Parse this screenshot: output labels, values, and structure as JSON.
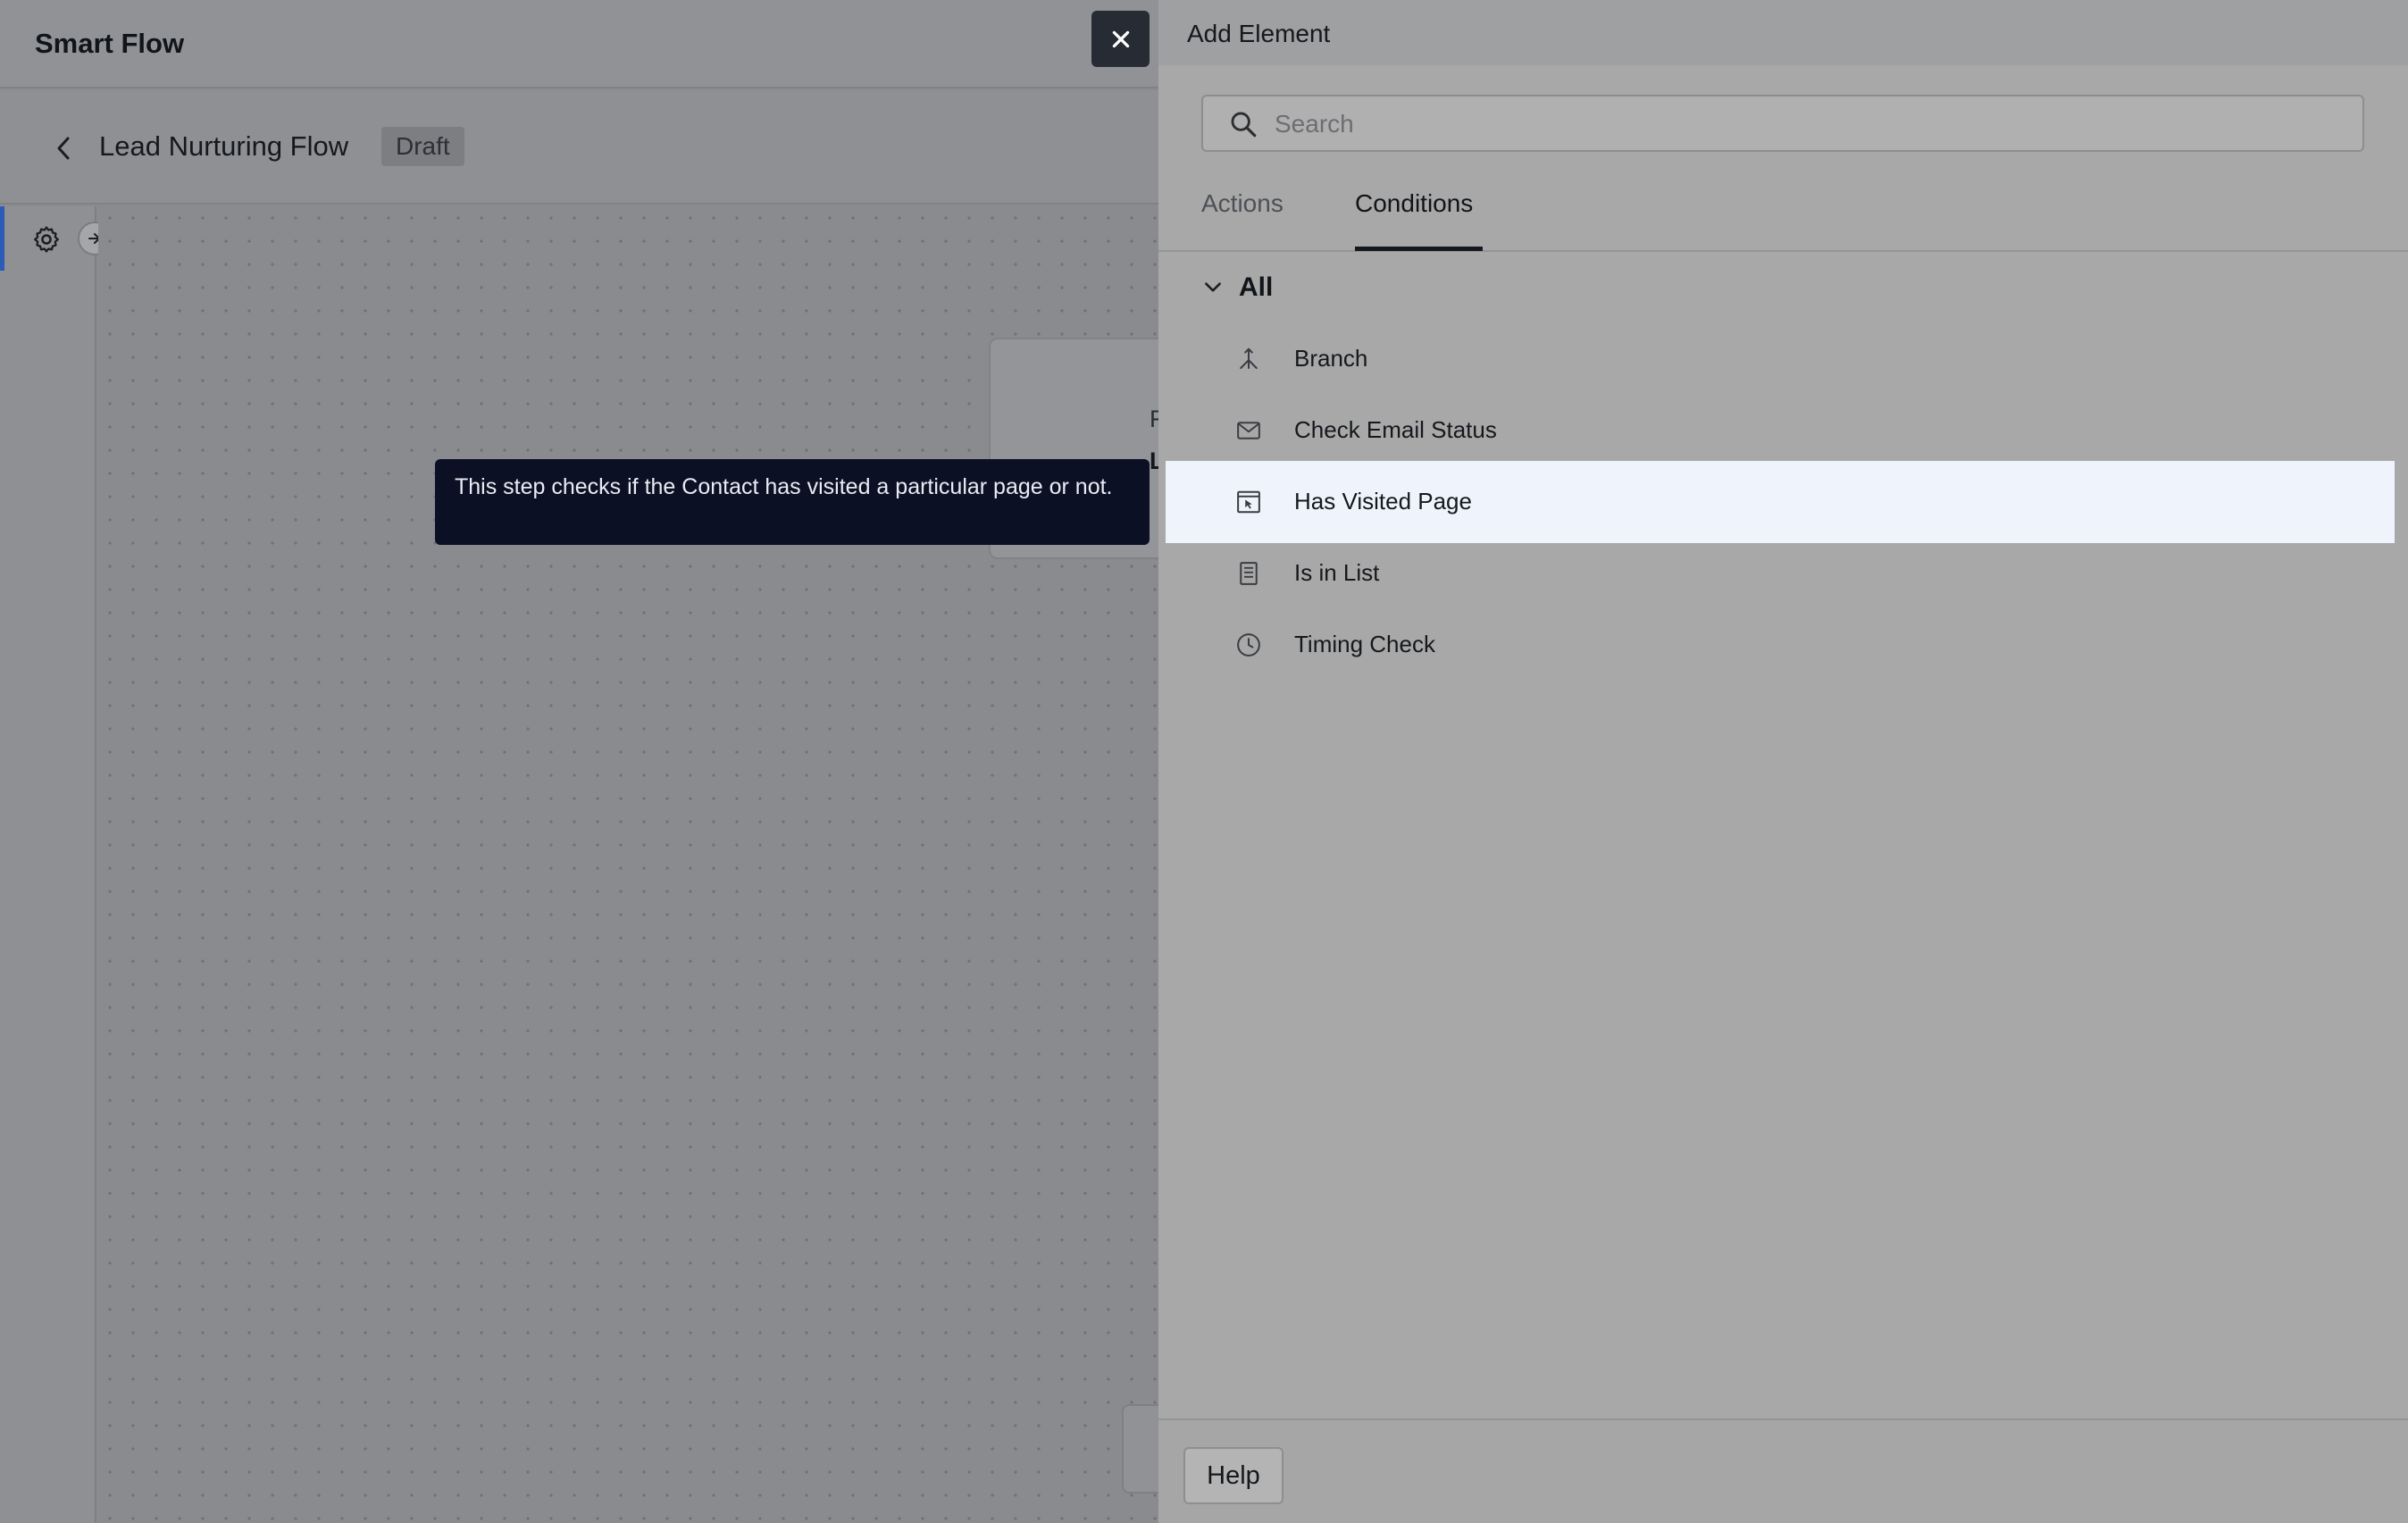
{
  "app": {
    "title": "Smart Flow"
  },
  "flow": {
    "name": "Lead Nurturing Flow",
    "status": "Draft"
  },
  "canvas": {
    "node_fragment_1": "F",
    "node_fragment_2": "L"
  },
  "tooltip": {
    "text": "This step checks if the Contact has visited a particular page or not."
  },
  "panel": {
    "title": "Add Element",
    "search": {
      "placeholder": "Search",
      "value": ""
    },
    "tabs": [
      {
        "label": "Actions",
        "active": false
      },
      {
        "label": "Conditions",
        "active": true
      }
    ],
    "group": {
      "label": "All",
      "expanded": true
    },
    "items": [
      {
        "label": "Branch",
        "icon": "branch-icon",
        "selected": false
      },
      {
        "label": "Check Email Status",
        "icon": "envelope-icon",
        "selected": false
      },
      {
        "label": "Has Visited Page",
        "icon": "visited-page-icon",
        "selected": true
      },
      {
        "label": "Is in List",
        "icon": "list-document-icon",
        "selected": false
      },
      {
        "label": "Timing Check",
        "icon": "clock-icon",
        "selected": false
      }
    ],
    "footer": {
      "help_label": "Help"
    }
  },
  "colors": {
    "overlay": "#8a8c90",
    "close_button": "#272b33",
    "tooltip_bg": "#0b1024",
    "selected_row": "#eff4fc",
    "rail_accent": "#2d5bb8"
  }
}
